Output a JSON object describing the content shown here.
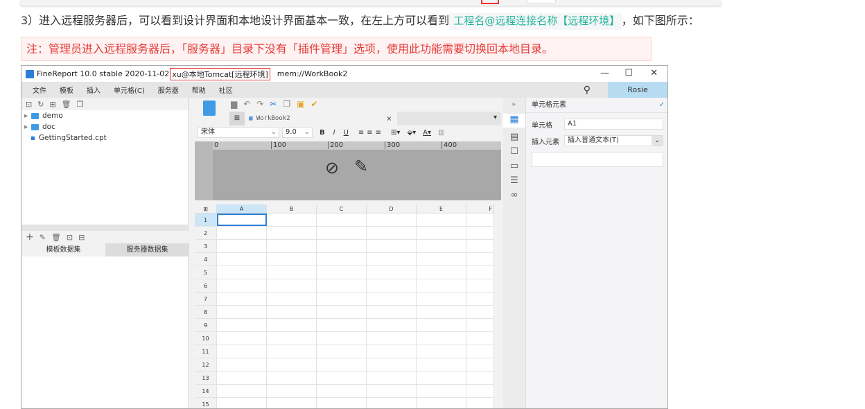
{
  "article": {
    "step_text": "3）进入远程服务器后，可以看到设计界面和本地设计界面基本一致，在左上方可以看到",
    "code_text": "工程名@远程连接名称【远程环境】",
    "step_suffix": "，如下图所示：",
    "note": "注：管理员进入远程服务器后，「服务器」目录下没有「插件管理」选项，使用此功能需要切换回本地目录。"
  },
  "window": {
    "title_prefix": "FineReport 10.0 stable 2020-11-02",
    "title_highlight": "xu@本地Tomcat[远程环境]",
    "title_suffix": "mem://WorkBook2",
    "minimize": "—",
    "maximize": "☐",
    "close": "✕"
  },
  "menu": [
    "文件",
    "模板",
    "插入",
    "单元格(C)",
    "服务器",
    "帮助",
    "社区"
  ],
  "user": "Rosie",
  "tree": [
    {
      "label": "demo",
      "type": "folder"
    },
    {
      "label": "doc",
      "type": "folder"
    },
    {
      "label": "GettingStarted.cpt",
      "type": "file"
    }
  ],
  "dataset_tabs": [
    "模板数据集",
    "服务器数据集"
  ],
  "tab": {
    "label": "WorkBook2",
    "close": "×"
  },
  "font": {
    "name": "宋体",
    "size": "9.0"
  },
  "format_buttons": [
    "B",
    "I",
    "U"
  ],
  "ruler_ticks": [
    "0",
    "100",
    "200",
    "300",
    "400"
  ],
  "columns": [
    "A",
    "B",
    "C",
    "D",
    "E",
    "F"
  ],
  "rows": [
    "1",
    "2",
    "3",
    "4",
    "5",
    "6",
    "7",
    "8",
    "9",
    "10",
    "11",
    "12",
    "13",
    "14",
    "15"
  ],
  "right_panel": {
    "title": "单元格元素",
    "cell_label": "单元格",
    "cell_value": "A1",
    "insert_label": "插入元素",
    "insert_value": "插入普通文本(T)"
  },
  "colors": {
    "accent": "#2a7fd9",
    "note_red": "#e53935",
    "code_teal": "#20b39a"
  }
}
